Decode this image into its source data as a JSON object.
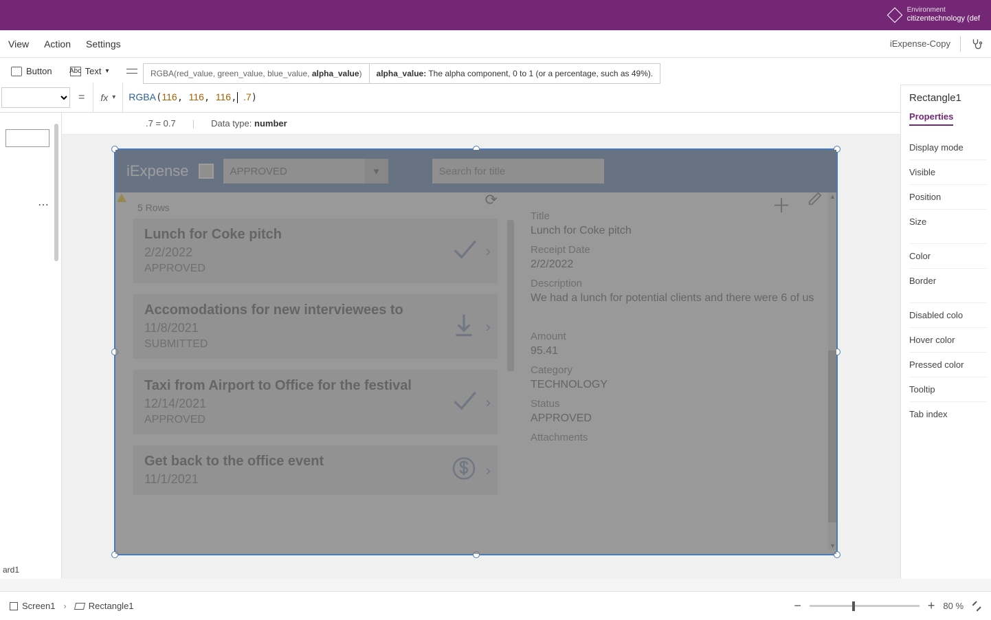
{
  "environment": {
    "label": "Environment",
    "name": "citizentechnology (def"
  },
  "menubar": {
    "view": "View",
    "action": "Action",
    "settings": "Settings",
    "appname": "iExpense-Copy"
  },
  "toolbar": {
    "button": "Button",
    "text": "Text"
  },
  "signature": {
    "template": "RGBA(red_value, green_value, blue_value, ",
    "bold_param": "alpha_value",
    "template_close": ")",
    "desc_label": "alpha_value:",
    "desc_text": " The alpha component, 0 to 1 (or a percentage, such as 49%)."
  },
  "formula": {
    "fn": "RGBA",
    "r": "116",
    "g": "116",
    "b": "116",
    "a": ".7",
    "eval": ".7  =  0.7",
    "dtype_label": "Data type: ",
    "dtype": "number"
  },
  "leftpane_bottom": "ard1",
  "preview": {
    "app_title": "iExpense",
    "dd_value": "APPROVED",
    "search_placeholder": "Search for title",
    "rows_label": "5 Rows",
    "detail": {
      "title_label": "Title",
      "title_val": "Lunch for Coke pitch",
      "date_label": "Receipt Date",
      "date_val": "2/2/2022",
      "desc_label": "Description",
      "desc_val": "We had a lunch for potential clients and there were 6 of us",
      "amount_label": "Amount",
      "amount_val": "95.41",
      "cat_label": "Category",
      "cat_val": "TECHNOLOGY",
      "status_label": "Status",
      "status_val": "APPROVED",
      "attach_label": "Attachments"
    },
    "items": [
      {
        "title": "Lunch for Coke pitch",
        "date": "2/2/2022",
        "status": "APPROVED",
        "icon": "check"
      },
      {
        "title": "Accomodations for new interviewees to",
        "date": "11/8/2021",
        "status": "SUBMITTED",
        "icon": "download"
      },
      {
        "title": "Taxi from Airport to Office for the festival",
        "date": "12/14/2021",
        "status": "APPROVED",
        "icon": "check"
      },
      {
        "title": "Get back to the office event",
        "date": "11/1/2021",
        "status": "",
        "icon": "dollar"
      }
    ]
  },
  "rightpane": {
    "sel_name": "Rectangle1",
    "tab": "Properties",
    "props": [
      "Display mode",
      "Visible",
      "Position",
      "Size",
      "Color",
      "Border",
      "Disabled colo",
      "Hover color",
      "Pressed color",
      "Tooltip",
      "Tab index"
    ]
  },
  "statusbar": {
    "crumb1": "Screen1",
    "crumb2": "Rectangle1",
    "zoom": "80",
    "zoom_pct": "%"
  }
}
